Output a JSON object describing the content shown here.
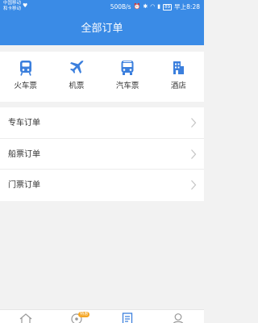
{
  "status_bar": {
    "carrier_line1": "中国移动",
    "carrier_line2": "和卡移动",
    "carrier_icon": "heart-icon",
    "network_speed": "500B/s",
    "battery_level": "89",
    "time": "早上8:28"
  },
  "header": {
    "title": "全部订单"
  },
  "categories": [
    {
      "label": "火车票",
      "icon": "train-icon"
    },
    {
      "label": "机票",
      "icon": "plane-icon"
    },
    {
      "label": "汽车票",
      "icon": "bus-icon"
    },
    {
      "label": "酒店",
      "icon": "hotel-icon"
    }
  ],
  "orders": [
    {
      "label": "专车订单"
    },
    {
      "label": "船票订单"
    },
    {
      "label": "门票订单"
    }
  ],
  "tabbar": {
    "tabs": [
      {
        "icon": "home-icon"
      },
      {
        "icon": "discover-icon",
        "badge": "特惠"
      },
      {
        "icon": "orders-icon"
      },
      {
        "icon": "profile-icon"
      }
    ]
  },
  "colors": {
    "primary": "#3a8be6",
    "icon": "#3b7fdd",
    "background": "#f2f2f2",
    "badge": "#f5a623"
  }
}
